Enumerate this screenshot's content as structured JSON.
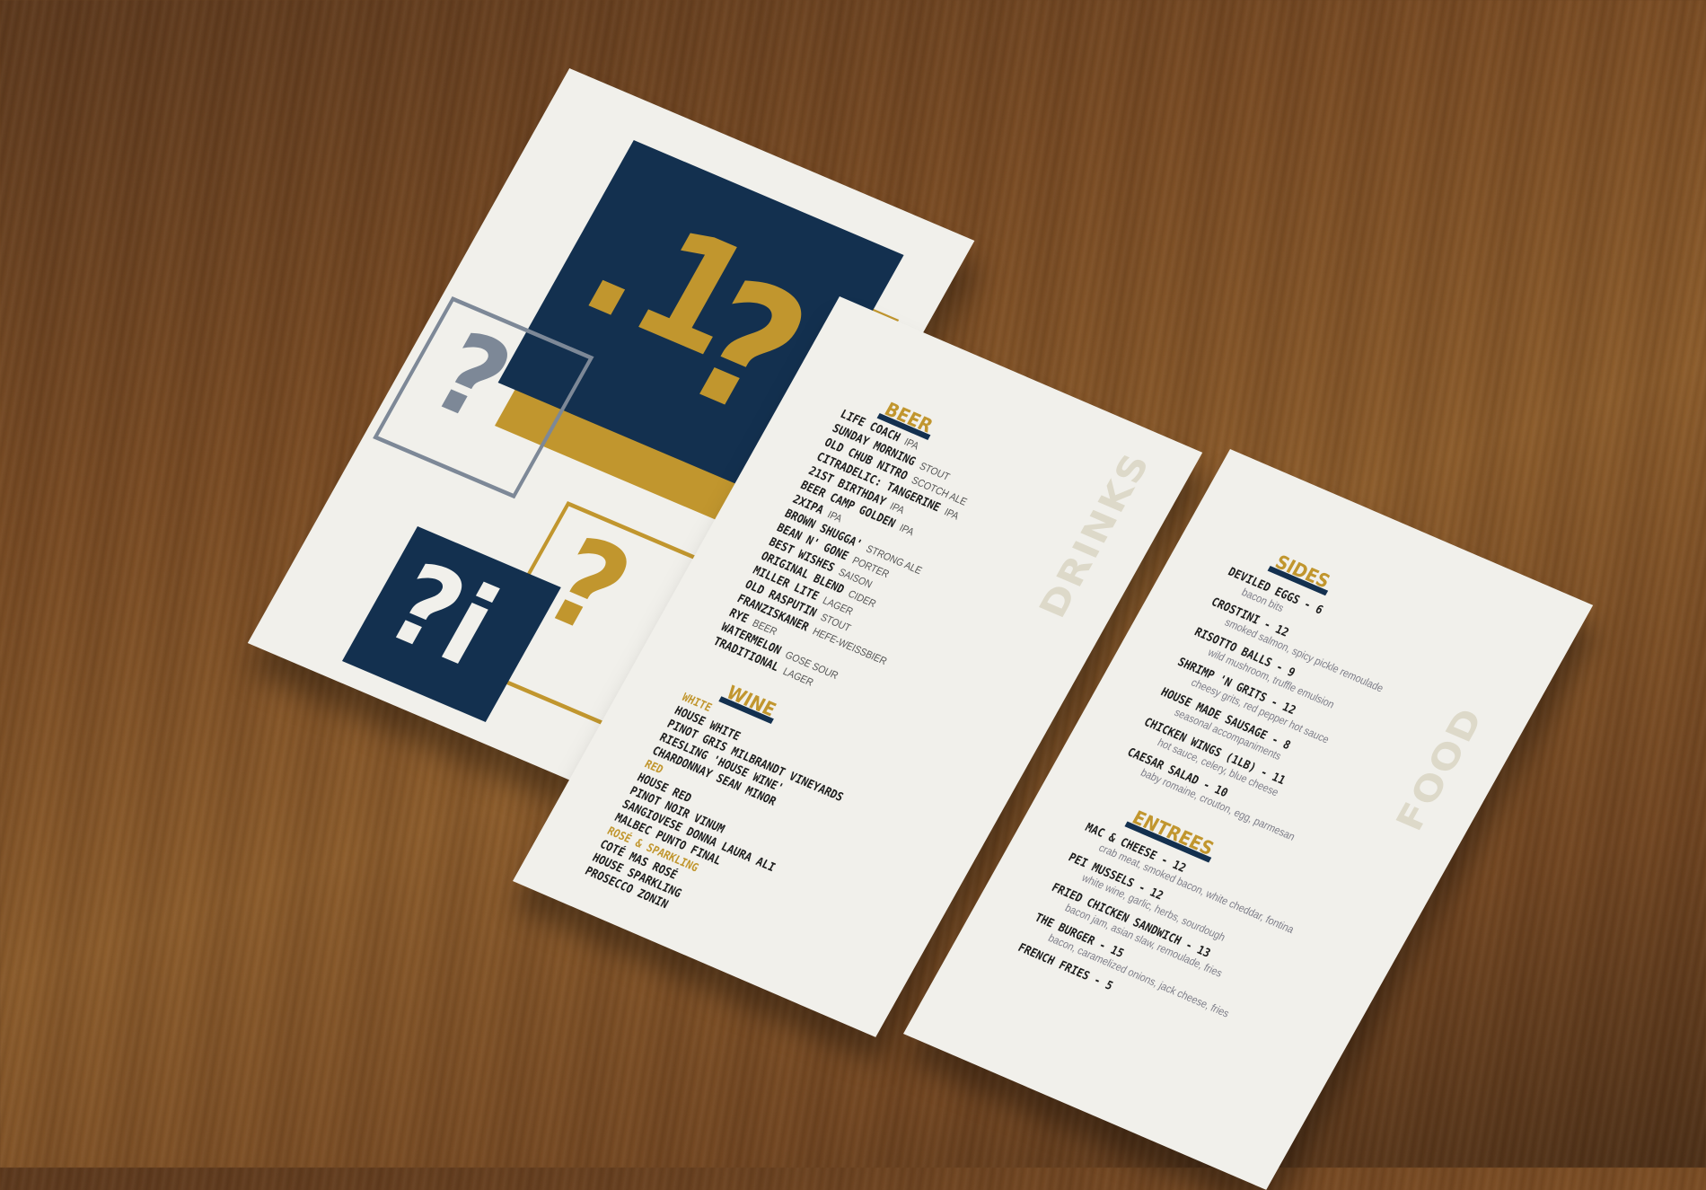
{
  "drinks": {
    "side_title": "DRINKS",
    "beer_title": "BEER",
    "beer": [
      {
        "name": "LIFE COACH",
        "style": "IPA"
      },
      {
        "name": "SUNDAY MORNING",
        "style": "STOUT"
      },
      {
        "name": "OLD CHUB NITRO",
        "style": "SCOTCH ALE"
      },
      {
        "name": "CITRADELIC: TANGERINE",
        "style": "IPA"
      },
      {
        "name": "21ST BIRTHDAY",
        "style": "IPA"
      },
      {
        "name": "BEER CAMP GOLDEN",
        "style": "IPA"
      },
      {
        "name": "2XIPA",
        "style": "IPA"
      },
      {
        "name": "BROWN SHUGGA'",
        "style": "STRONG ALE"
      },
      {
        "name": "BEAN N' GONE",
        "style": "PORTER"
      },
      {
        "name": "BEST WISHES",
        "style": "SAISON"
      },
      {
        "name": "ORIGINAL BLEND",
        "style": "CIDER"
      },
      {
        "name": "MILLER LITE",
        "style": "LAGER"
      },
      {
        "name": "OLD RASPUTIN",
        "style": "STOUT"
      },
      {
        "name": "FRANZISKANER",
        "style": "HEFE-WEISSBIER"
      },
      {
        "name": "RYE",
        "style": "BEER"
      },
      {
        "name": "WATERMELON",
        "style": "GOSE SOUR"
      },
      {
        "name": "TRADITIONAL",
        "style": "LAGER"
      }
    ],
    "wine_title": "WINE",
    "white_label": "WHITE",
    "white": [
      "HOUSE WHITE",
      "PINOT GRIS MILBRANDT VINEYARDS",
      "RIESLING 'HOUSE WINE'",
      "CHARDONNAY SEAN MINOR"
    ],
    "red_label": "RED",
    "red": [
      "HOUSE RED",
      "PINOT NOIR VINUM",
      "SANGIOVESE DONNA LAURA ALI",
      "MALBEC PUNTO FINAL"
    ],
    "rose_label": "ROSÉ & SPARKLING",
    "rose": [
      "COTÉ MAS ROSÉ",
      "HOUSE SPARKLING",
      "PROSECCO ZONIN"
    ]
  },
  "food": {
    "side_title": "FOOD",
    "sides_title": "SIDES",
    "sides": [
      {
        "name": "DEVILED EGGS - 6",
        "desc": "bacon bits"
      },
      {
        "name": "CROSTINI - 12",
        "desc": "smoked salmon, spicy pickle remoulade"
      },
      {
        "name": "RISOTTO BALLS - 9",
        "desc": "wild mushroom, truffle emulsion"
      },
      {
        "name": "SHRIMP 'N GRITS - 12",
        "desc": "cheesy grits, red pepper hot sauce"
      },
      {
        "name": "HOUSE MADE SAUSAGE - 8",
        "desc": "seasonal accompaniments"
      },
      {
        "name": "CHICKEN WINGS (1LB) - 11",
        "desc": "hot sauce, celery, blue cheese"
      },
      {
        "name": "CAESAR SALAD - 10",
        "desc": "baby romaine, crouton, egg, parmesan"
      }
    ],
    "entrees_title": "ENTREES",
    "entrees": [
      {
        "name": "MAC & CHEESE - 12",
        "desc": "crab meat, smoked bacon, white cheddar, fontina"
      },
      {
        "name": "PEI MUSSELS - 12",
        "desc": "white wine, garlic, herbs, sourdough"
      },
      {
        "name": "FRIED CHICKEN SANDWICH - 13",
        "desc": "bacon jam, asian slaw, remoulade, fries"
      },
      {
        "name": "THE BURGER - 15",
        "desc": "bacon, caramelized onions, jack cheese, fries"
      },
      {
        "name": "FRENCH FRIES - 5",
        "desc": ""
      }
    ]
  },
  "colors": {
    "navy": "#13304f",
    "gold": "#c1962e",
    "paper": "#f1f0eb",
    "wood": "#7a4c24"
  }
}
